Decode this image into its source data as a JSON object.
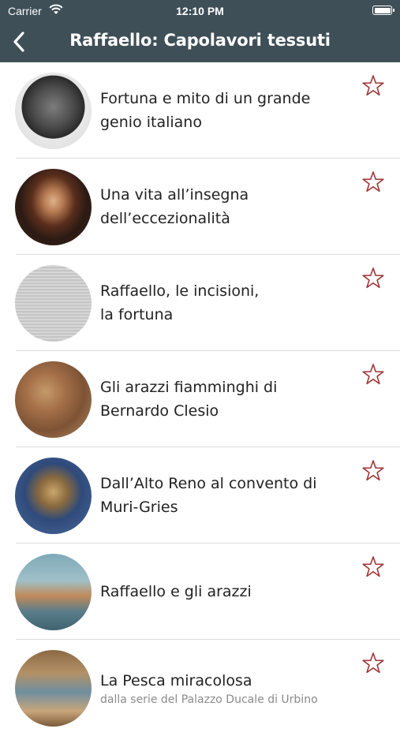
{
  "status_bar": {
    "carrier": "Carrier",
    "time": "12:10 PM",
    "wifi_icon": "wifi-icon",
    "battery_icon": "battery-icon"
  },
  "nav": {
    "title": "Raffaello: Capolavori tessuti",
    "back_icon": "chevron-left-icon"
  },
  "colors": {
    "bar": "#3f4f57",
    "star": "#a0383a",
    "separator": "#dcdcdc"
  },
  "items": [
    {
      "title": "Fortuna e mito di un grande\ngenio italiano",
      "subtitle": ""
    },
    {
      "title": "Una vita all’insegna\ndell’eccezionalità",
      "subtitle": ""
    },
    {
      "title": "Raffaello, le incisioni,\nla fortuna",
      "subtitle": ""
    },
    {
      "title": "Gli arazzi fiamminghi di\nBernardo Clesio",
      "subtitle": ""
    },
    {
      "title": "Dall’Alto Reno al convento di\nMuri-Gries",
      "subtitle": ""
    },
    {
      "title": "Raffaello e gli arazzi",
      "subtitle": ""
    },
    {
      "title": "La Pesca miracolosa",
      "subtitle": "dalla serie del Palazzo Ducale di Urbino"
    }
  ]
}
